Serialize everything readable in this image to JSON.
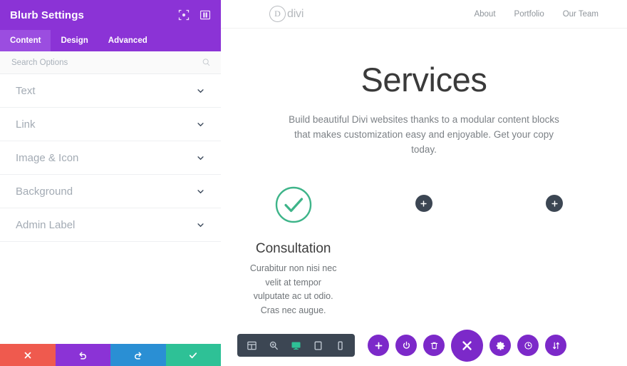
{
  "settings_panel": {
    "title": "Blurb Settings",
    "header_icons": [
      {
        "name": "focus-target-icon"
      },
      {
        "name": "layout-columns-icon"
      }
    ],
    "tabs": [
      {
        "label": "Content",
        "active": true
      },
      {
        "label": "Design",
        "active": false
      },
      {
        "label": "Advanced",
        "active": false
      }
    ],
    "search": {
      "placeholder": "Search Options",
      "value": "",
      "icon": "search-icon"
    },
    "sections": [
      {
        "label": "Text",
        "icon": "chevron-down-icon"
      },
      {
        "label": "Link",
        "icon": "chevron-down-icon"
      },
      {
        "label": "Image & Icon",
        "icon": "chevron-down-icon"
      },
      {
        "label": "Background",
        "icon": "chevron-down-icon"
      },
      {
        "label": "Admin Label",
        "icon": "chevron-down-icon"
      }
    ],
    "footer_buttons": [
      {
        "name": "cancel-button",
        "icon": "close-x-icon",
        "color": "#ef5a4e"
      },
      {
        "name": "undo-button",
        "icon": "undo-arrow-icon",
        "color": "#8b33d6"
      },
      {
        "name": "redo-button",
        "icon": "redo-arrow-icon",
        "color": "#2a8fd4"
      },
      {
        "name": "save-button",
        "icon": "checkmark-icon",
        "color": "#2ec196"
      }
    ],
    "colors": {
      "header": "#8b33d6",
      "tab_active": "#9b4de0"
    }
  },
  "site": {
    "logo": {
      "mark": "D",
      "text": "divi"
    },
    "nav": [
      {
        "label": "About"
      },
      {
        "label": "Portfolio"
      },
      {
        "label": "Our Team"
      }
    ],
    "hero": {
      "title": "Services",
      "subtitle": "Build beautiful Divi websites thanks to a modular content blocks that makes customization easy and enjoyable. Get your copy today."
    },
    "blurb": {
      "icon": "check-circle-icon",
      "icon_color": "#3eb489",
      "title": "Consultation",
      "text": "Curabitur non nisi nec velit at tempor vulputate ac ut odio. Cras nec augue."
    },
    "empty_columns": [
      {
        "name": "add-module-button",
        "icon": "plus-icon"
      },
      {
        "name": "add-module-button",
        "icon": "plus-icon"
      }
    ]
  },
  "builder_toolbar": {
    "view_modes": [
      {
        "name": "wireframe-view-button",
        "icon": "wireframe-grid-icon",
        "active": false
      },
      {
        "name": "zoom-view-button",
        "icon": "magnifier-icon",
        "active": false
      },
      {
        "name": "desktop-view-button",
        "icon": "desktop-monitor-icon",
        "active": true
      },
      {
        "name": "tablet-view-button",
        "icon": "tablet-icon",
        "active": false
      },
      {
        "name": "phone-view-button",
        "icon": "phone-icon",
        "active": false
      }
    ],
    "actions": [
      {
        "name": "add-section-button",
        "icon": "plus-icon",
        "size": "small"
      },
      {
        "name": "toggle-builder-button",
        "icon": "power-icon",
        "size": "small"
      },
      {
        "name": "delete-button",
        "icon": "trash-icon",
        "size": "small"
      },
      {
        "name": "close-builder-button",
        "icon": "close-x-icon",
        "size": "large"
      },
      {
        "name": "settings-button",
        "icon": "gear-icon",
        "size": "small"
      },
      {
        "name": "history-button",
        "icon": "clock-icon",
        "size": "small"
      },
      {
        "name": "portability-button",
        "icon": "sort-arrows-icon",
        "size": "small"
      }
    ],
    "colors": {
      "button": "#7c29c9",
      "group_bg": "#3c4653",
      "active_mode": "#2ec196"
    }
  }
}
